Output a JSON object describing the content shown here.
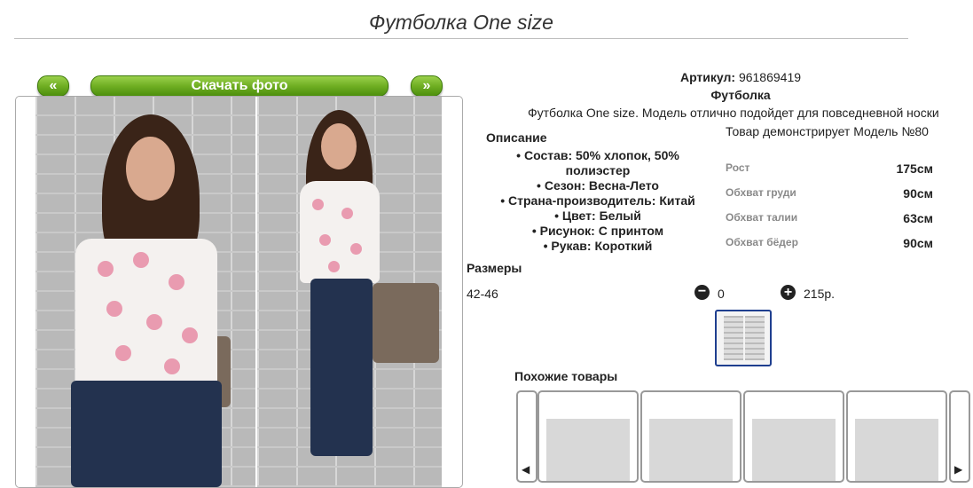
{
  "title": "Футболка One size",
  "nav": {
    "prev": "«",
    "download": "Скачать фото",
    "next": "»"
  },
  "product": {
    "article_label": "Артикул:",
    "article_value": "961869419",
    "name": "Футболка",
    "description": "Футболка One size. Модель отлично подойдет для повседневной носки",
    "model_note": "Товар демонстрирует Модель №80"
  },
  "description_block": {
    "heading": "Описание",
    "items": [
      "Состав: 50% хлопок, 50% полиэстер",
      "Сезон: Весна-Лето",
      "Страна-производитель: Китай",
      "Цвет: Белый",
      "Рисунок: С принтом",
      "Рукав: Короткий"
    ]
  },
  "measurements": [
    {
      "label": "Рост",
      "value": "175см"
    },
    {
      "label": "Обхват груди",
      "value": "90см"
    },
    {
      "label": "Обхват талии",
      "value": "63см"
    },
    {
      "label": "Обхват бёдер",
      "value": "90см"
    }
  ],
  "sizes": {
    "heading": "Размеры",
    "size": "42-46",
    "minus": "−",
    "quantity": "0",
    "plus": "+",
    "price": "215р."
  },
  "similar": {
    "heading": "Похожие товары",
    "prev": "◀",
    "next": "▶"
  },
  "icons": [
    "prev-arrow-icon",
    "next-arrow-icon",
    "minus-circle-icon",
    "plus-circle-icon"
  ],
  "colors": {
    "accent_green": "#6fae22",
    "thumb_border": "#1f3f8f"
  }
}
